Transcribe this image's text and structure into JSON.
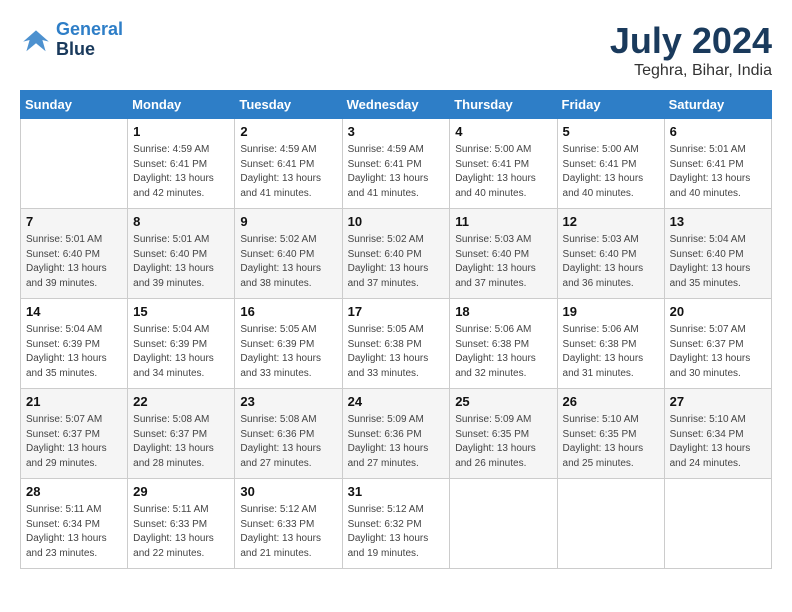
{
  "logo": {
    "line1": "General",
    "line2": "Blue"
  },
  "title": "July 2024",
  "location": "Teghra, Bihar, India",
  "days_of_week": [
    "Sunday",
    "Monday",
    "Tuesday",
    "Wednesday",
    "Thursday",
    "Friday",
    "Saturday"
  ],
  "weeks": [
    [
      {
        "day": "",
        "info": ""
      },
      {
        "day": "1",
        "info": "Sunrise: 4:59 AM\nSunset: 6:41 PM\nDaylight: 13 hours\nand 42 minutes."
      },
      {
        "day": "2",
        "info": "Sunrise: 4:59 AM\nSunset: 6:41 PM\nDaylight: 13 hours\nand 41 minutes."
      },
      {
        "day": "3",
        "info": "Sunrise: 4:59 AM\nSunset: 6:41 PM\nDaylight: 13 hours\nand 41 minutes."
      },
      {
        "day": "4",
        "info": "Sunrise: 5:00 AM\nSunset: 6:41 PM\nDaylight: 13 hours\nand 40 minutes."
      },
      {
        "day": "5",
        "info": "Sunrise: 5:00 AM\nSunset: 6:41 PM\nDaylight: 13 hours\nand 40 minutes."
      },
      {
        "day": "6",
        "info": "Sunrise: 5:01 AM\nSunset: 6:41 PM\nDaylight: 13 hours\nand 40 minutes."
      }
    ],
    [
      {
        "day": "7",
        "info": "Sunrise: 5:01 AM\nSunset: 6:40 PM\nDaylight: 13 hours\nand 39 minutes."
      },
      {
        "day": "8",
        "info": "Sunrise: 5:01 AM\nSunset: 6:40 PM\nDaylight: 13 hours\nand 39 minutes."
      },
      {
        "day": "9",
        "info": "Sunrise: 5:02 AM\nSunset: 6:40 PM\nDaylight: 13 hours\nand 38 minutes."
      },
      {
        "day": "10",
        "info": "Sunrise: 5:02 AM\nSunset: 6:40 PM\nDaylight: 13 hours\nand 37 minutes."
      },
      {
        "day": "11",
        "info": "Sunrise: 5:03 AM\nSunset: 6:40 PM\nDaylight: 13 hours\nand 37 minutes."
      },
      {
        "day": "12",
        "info": "Sunrise: 5:03 AM\nSunset: 6:40 PM\nDaylight: 13 hours\nand 36 minutes."
      },
      {
        "day": "13",
        "info": "Sunrise: 5:04 AM\nSunset: 6:40 PM\nDaylight: 13 hours\nand 35 minutes."
      }
    ],
    [
      {
        "day": "14",
        "info": "Sunrise: 5:04 AM\nSunset: 6:39 PM\nDaylight: 13 hours\nand 35 minutes."
      },
      {
        "day": "15",
        "info": "Sunrise: 5:04 AM\nSunset: 6:39 PM\nDaylight: 13 hours\nand 34 minutes."
      },
      {
        "day": "16",
        "info": "Sunrise: 5:05 AM\nSunset: 6:39 PM\nDaylight: 13 hours\nand 33 minutes."
      },
      {
        "day": "17",
        "info": "Sunrise: 5:05 AM\nSunset: 6:38 PM\nDaylight: 13 hours\nand 33 minutes."
      },
      {
        "day": "18",
        "info": "Sunrise: 5:06 AM\nSunset: 6:38 PM\nDaylight: 13 hours\nand 32 minutes."
      },
      {
        "day": "19",
        "info": "Sunrise: 5:06 AM\nSunset: 6:38 PM\nDaylight: 13 hours\nand 31 minutes."
      },
      {
        "day": "20",
        "info": "Sunrise: 5:07 AM\nSunset: 6:37 PM\nDaylight: 13 hours\nand 30 minutes."
      }
    ],
    [
      {
        "day": "21",
        "info": "Sunrise: 5:07 AM\nSunset: 6:37 PM\nDaylight: 13 hours\nand 29 minutes."
      },
      {
        "day": "22",
        "info": "Sunrise: 5:08 AM\nSunset: 6:37 PM\nDaylight: 13 hours\nand 28 minutes."
      },
      {
        "day": "23",
        "info": "Sunrise: 5:08 AM\nSunset: 6:36 PM\nDaylight: 13 hours\nand 27 minutes."
      },
      {
        "day": "24",
        "info": "Sunrise: 5:09 AM\nSunset: 6:36 PM\nDaylight: 13 hours\nand 27 minutes."
      },
      {
        "day": "25",
        "info": "Sunrise: 5:09 AM\nSunset: 6:35 PM\nDaylight: 13 hours\nand 26 minutes."
      },
      {
        "day": "26",
        "info": "Sunrise: 5:10 AM\nSunset: 6:35 PM\nDaylight: 13 hours\nand 25 minutes."
      },
      {
        "day": "27",
        "info": "Sunrise: 5:10 AM\nSunset: 6:34 PM\nDaylight: 13 hours\nand 24 minutes."
      }
    ],
    [
      {
        "day": "28",
        "info": "Sunrise: 5:11 AM\nSunset: 6:34 PM\nDaylight: 13 hours\nand 23 minutes."
      },
      {
        "day": "29",
        "info": "Sunrise: 5:11 AM\nSunset: 6:33 PM\nDaylight: 13 hours\nand 22 minutes."
      },
      {
        "day": "30",
        "info": "Sunrise: 5:12 AM\nSunset: 6:33 PM\nDaylight: 13 hours\nand 21 minutes."
      },
      {
        "day": "31",
        "info": "Sunrise: 5:12 AM\nSunset: 6:32 PM\nDaylight: 13 hours\nand 19 minutes."
      },
      {
        "day": "",
        "info": ""
      },
      {
        "day": "",
        "info": ""
      },
      {
        "day": "",
        "info": ""
      }
    ]
  ]
}
